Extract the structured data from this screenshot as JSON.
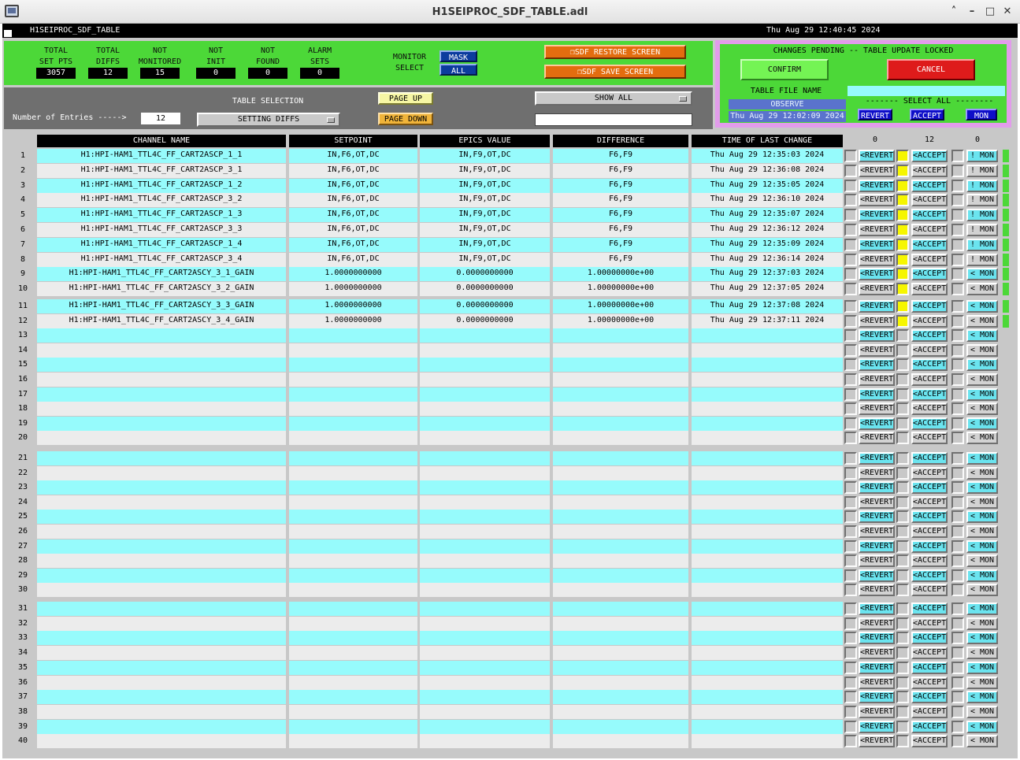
{
  "window": {
    "title": "H1SEIPROC_SDF_TABLE.adl"
  },
  "header": {
    "name": "H1SEIPROC_SDF_TABLE",
    "datetime": "Thu Aug 29 12:40:45 2024"
  },
  "stats": [
    {
      "label1": "TOTAL",
      "label2": "SET PTS",
      "value": "3057"
    },
    {
      "label1": "TOTAL",
      "label2": "DIFFS",
      "value": "12"
    },
    {
      "label1": "NOT",
      "label2": "MONITORED",
      "value": "15"
    },
    {
      "label1": "NOT",
      "label2": "INIT",
      "value": "0"
    },
    {
      "label1": "NOT",
      "label2": "FOUND",
      "value": "0"
    },
    {
      "label1": "ALARM",
      "label2": "SETS",
      "value": "0"
    }
  ],
  "monitor": {
    "label1": "MONITOR",
    "label2": "SELECT",
    "mask": "MASK",
    "all": "ALL"
  },
  "restore_label": "❐SDF RESTORE SCREEN",
  "save_label": "❐SDF SAVE SCREEN",
  "pending": {
    "title": "CHANGES PENDING -- TABLE UPDATE LOCKED",
    "confirm": "CONFIRM",
    "cancel": "CANCEL"
  },
  "file": {
    "label": "TABLE FILE NAME",
    "name": "OBSERVE",
    "date": "Thu Aug 29 12:02:09 2024"
  },
  "selectall": {
    "label": "------- SELECT ALL --------",
    "revert": "REVERT",
    "accept": "ACCEPT",
    "mon": "MON"
  },
  "nav": {
    "entries_label": "Number of Entries ----->",
    "entries_value": "12",
    "table_selection_label": "TABLE SELECTION",
    "table_selection_value": "SETTING DIFFS",
    "page_up": "PAGE UP",
    "page_down": "PAGE DOWN",
    "show_all": "SHOW ALL"
  },
  "columns": {
    "channel": "CHANNEL NAME",
    "setpoint": "SETPOINT",
    "epics": "EPICS VALUE",
    "difference": "DIFFERENCE",
    "time": "TIME OF LAST CHANGE",
    "count_revert": "0",
    "count_accept": "12",
    "count_mon": "0"
  },
  "buttons": {
    "revert": "<REVERT",
    "accept": "<ACCEPT",
    "mon_excl": "! MON",
    "mon_lt": "< MON"
  },
  "rows": [
    {
      "n": "1",
      "channel": "H1:HPI-HAM1_TTL4C_FF_CART2ASCP_1_1",
      "setpoint": "IN,F6,OT,DC",
      "epics": "IN,F9,OT,DC",
      "difference": "F6,F9",
      "time": "Thu Aug 29 12:35:03 2024"
    },
    {
      "n": "2",
      "channel": "H1:HPI-HAM1_TTL4C_FF_CART2ASCP_3_1",
      "setpoint": "IN,F6,OT,DC",
      "epics": "IN,F9,OT,DC",
      "difference": "F6,F9",
      "time": "Thu Aug 29 12:36:08 2024"
    },
    {
      "n": "3",
      "channel": "H1:HPI-HAM1_TTL4C_FF_CART2ASCP_1_2",
      "setpoint": "IN,F6,OT,DC",
      "epics": "IN,F9,OT,DC",
      "difference": "F6,F9",
      "time": "Thu Aug 29 12:35:05 2024"
    },
    {
      "n": "4",
      "channel": "H1:HPI-HAM1_TTL4C_FF_CART2ASCP_3_2",
      "setpoint": "IN,F6,OT,DC",
      "epics": "IN,F9,OT,DC",
      "difference": "F6,F9",
      "time": "Thu Aug 29 12:36:10 2024"
    },
    {
      "n": "5",
      "channel": "H1:HPI-HAM1_TTL4C_FF_CART2ASCP_1_3",
      "setpoint": "IN,F6,OT,DC",
      "epics": "IN,F9,OT,DC",
      "difference": "F6,F9",
      "time": "Thu Aug 29 12:35:07 2024"
    },
    {
      "n": "6",
      "channel": "H1:HPI-HAM1_TTL4C_FF_CART2ASCP_3_3",
      "setpoint": "IN,F6,OT,DC",
      "epics": "IN,F9,OT,DC",
      "difference": "F6,F9",
      "time": "Thu Aug 29 12:36:12 2024"
    },
    {
      "n": "7",
      "channel": "H1:HPI-HAM1_TTL4C_FF_CART2ASCP_1_4",
      "setpoint": "IN,F6,OT,DC",
      "epics": "IN,F9,OT,DC",
      "difference": "F6,F9",
      "time": "Thu Aug 29 12:35:09 2024"
    },
    {
      "n": "8",
      "channel": "H1:HPI-HAM1_TTL4C_FF_CART2ASCP_3_4",
      "setpoint": "IN,F6,OT,DC",
      "epics": "IN,F9,OT,DC",
      "difference": "F6,F9",
      "time": "Thu Aug 29 12:36:14 2024"
    },
    {
      "n": "9",
      "channel": "H1:HPI-HAM1_TTL4C_FF_CART2ASCY_3_1_GAIN",
      "setpoint": "1.0000000000",
      "epics": "0.0000000000",
      "difference": "1.00000000e+00",
      "time": "Thu Aug 29 12:37:03 2024"
    },
    {
      "n": "10",
      "channel": "H1:HPI-HAM1_TTL4C_FF_CART2ASCY_3_2_GAIN",
      "setpoint": "1.0000000000",
      "epics": "0.0000000000",
      "difference": "1.00000000e+00",
      "time": "Thu Aug 29 12:37:05 2024"
    },
    {
      "n": "11",
      "channel": "H1:HPI-HAM1_TTL4C_FF_CART2ASCY_3_3_GAIN",
      "setpoint": "1.0000000000",
      "epics": "0.0000000000",
      "difference": "1.00000000e+00",
      "time": "Thu Aug 29 12:37:08 2024"
    },
    {
      "n": "12",
      "channel": "H1:HPI-HAM1_TTL4C_FF_CART2ASCY_3_4_GAIN",
      "setpoint": "1.0000000000",
      "epics": "0.0000000000",
      "difference": "1.00000000e+00",
      "time": "Thu Aug 29 12:37:11 2024"
    },
    {
      "n": "13",
      "channel": "",
      "setpoint": "",
      "epics": "",
      "difference": "",
      "time": ""
    },
    {
      "n": "14",
      "channel": "",
      "setpoint": "",
      "epics": "",
      "difference": "",
      "time": ""
    },
    {
      "n": "15",
      "channel": "",
      "setpoint": "",
      "epics": "",
      "difference": "",
      "time": ""
    },
    {
      "n": "16",
      "channel": "",
      "setpoint": "",
      "epics": "",
      "difference": "",
      "time": ""
    },
    {
      "n": "17",
      "channel": "",
      "setpoint": "",
      "epics": "",
      "difference": "",
      "time": ""
    },
    {
      "n": "18",
      "channel": "",
      "setpoint": "",
      "epics": "",
      "difference": "",
      "time": ""
    },
    {
      "n": "19",
      "channel": "",
      "setpoint": "",
      "epics": "",
      "difference": "",
      "time": ""
    },
    {
      "n": "20",
      "channel": "",
      "setpoint": "",
      "epics": "",
      "difference": "",
      "time": ""
    },
    {
      "n": "21",
      "channel": "",
      "setpoint": "",
      "epics": "",
      "difference": "",
      "time": ""
    },
    {
      "n": "22",
      "channel": "",
      "setpoint": "",
      "epics": "",
      "difference": "",
      "time": ""
    },
    {
      "n": "23",
      "channel": "",
      "setpoint": "",
      "epics": "",
      "difference": "",
      "time": ""
    },
    {
      "n": "24",
      "channel": "",
      "setpoint": "",
      "epics": "",
      "difference": "",
      "time": ""
    },
    {
      "n": "25",
      "channel": "",
      "setpoint": "",
      "epics": "",
      "difference": "",
      "time": ""
    },
    {
      "n": "26",
      "channel": "",
      "setpoint": "",
      "epics": "",
      "difference": "",
      "time": ""
    },
    {
      "n": "27",
      "channel": "",
      "setpoint": "",
      "epics": "",
      "difference": "",
      "time": ""
    },
    {
      "n": "28",
      "channel": "",
      "setpoint": "",
      "epics": "",
      "difference": "",
      "time": ""
    },
    {
      "n": "29",
      "channel": "",
      "setpoint": "",
      "epics": "",
      "difference": "",
      "time": ""
    },
    {
      "n": "30",
      "channel": "",
      "setpoint": "",
      "epics": "",
      "difference": "",
      "time": ""
    },
    {
      "n": "31",
      "channel": "",
      "setpoint": "",
      "epics": "",
      "difference": "",
      "time": ""
    },
    {
      "n": "32",
      "channel": "",
      "setpoint": "",
      "epics": "",
      "difference": "",
      "time": ""
    },
    {
      "n": "33",
      "channel": "",
      "setpoint": "",
      "epics": "",
      "difference": "",
      "time": ""
    },
    {
      "n": "34",
      "channel": "",
      "setpoint": "",
      "epics": "",
      "difference": "",
      "time": ""
    },
    {
      "n": "35",
      "channel": "",
      "setpoint": "",
      "epics": "",
      "difference": "",
      "time": ""
    },
    {
      "n": "36",
      "channel": "",
      "setpoint": "",
      "epics": "",
      "difference": "",
      "time": ""
    },
    {
      "n": "37",
      "channel": "",
      "setpoint": "",
      "epics": "",
      "difference": "",
      "time": ""
    },
    {
      "n": "38",
      "channel": "",
      "setpoint": "",
      "epics": "",
      "difference": "",
      "time": ""
    },
    {
      "n": "39",
      "channel": "",
      "setpoint": "",
      "epics": "",
      "difference": "",
      "time": ""
    },
    {
      "n": "40",
      "channel": "",
      "setpoint": "",
      "epics": "",
      "difference": "",
      "time": ""
    }
  ],
  "colors": {
    "panel_green": "#4cd838",
    "row_cyan": "#96fbfc",
    "row_gray": "#ececec",
    "orange": "#e36d0f",
    "blue": "#0c3c9e",
    "cancel_red": "#de1b1b"
  }
}
